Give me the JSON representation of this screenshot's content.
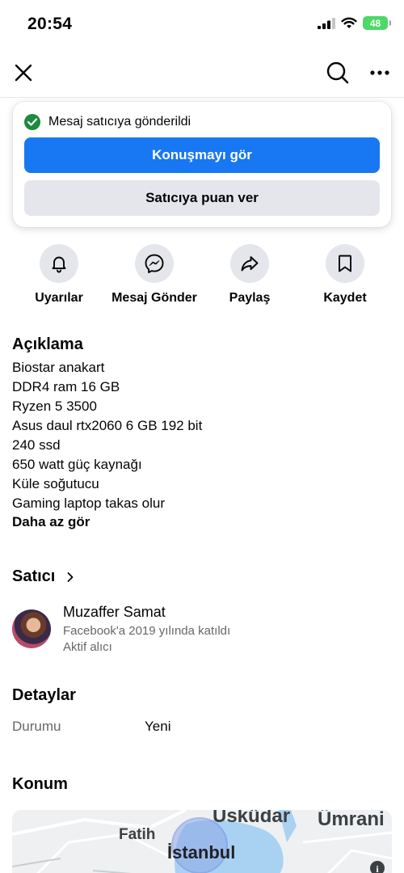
{
  "status_bar": {
    "time": "20:54",
    "battery": "48"
  },
  "toast": {
    "status_text": "Mesaj satıcıya gönderildi",
    "primary_label": "Konuşmayı gör",
    "secondary_label": "Satıcıya puan ver"
  },
  "actions": [
    {
      "label": "Uyarılar",
      "icon": "bell-icon"
    },
    {
      "label": "Mesaj Gönder",
      "icon": "messenger-icon"
    },
    {
      "label": "Paylaş",
      "icon": "share-icon"
    },
    {
      "label": "Kaydet",
      "icon": "bookmark-icon"
    }
  ],
  "description": {
    "title": "Açıklama",
    "lines": [
      "Biostar anakart",
      "DDR4 ram 16 GB",
      "Ryzen 5 3500",
      "Asus daul rtx2060 6 GB 192 bit",
      "240 ssd",
      "650 watt güç kaynağı",
      "Küle soğutucu",
      "Gaming laptop takas olur"
    ],
    "see_less": "Daha az gör"
  },
  "seller": {
    "title": "Satıcı",
    "name": "Muzaffer Samat",
    "joined": "Facebook'a 2019 yılında katıldı",
    "badge": "Aktif alıcı"
  },
  "details": {
    "title": "Detaylar",
    "label": "Durumu",
    "value": "Yeni"
  },
  "location": {
    "title": "Konum",
    "map_labels": {
      "uskudar": "Üsküdar",
      "umraniye": "Ümrani",
      "fatih": "Fatih",
      "istanbul": "İstanbul"
    }
  },
  "colors": {
    "accent": "#1877f2",
    "success": "#1d8a3e",
    "secondary_bg": "#e4e6eb",
    "muted_text": "#65676b"
  }
}
